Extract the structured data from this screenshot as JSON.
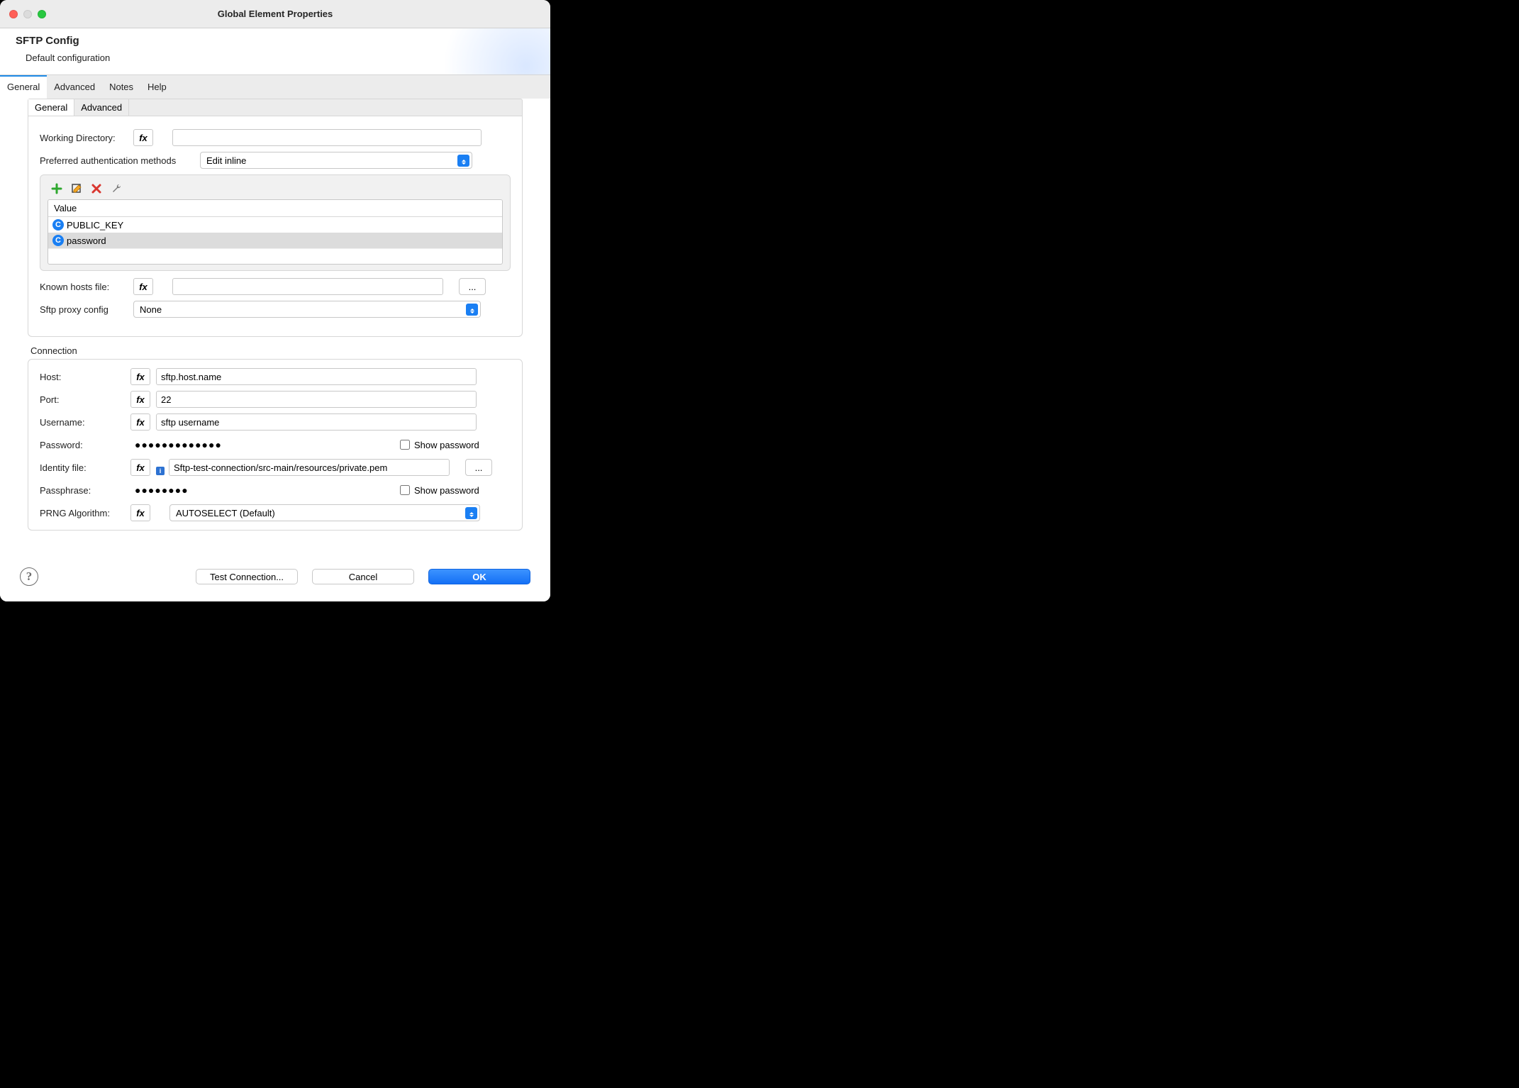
{
  "window": {
    "title": "Global Element Properties",
    "config_name": "SFTP Config",
    "config_subtitle": "Default configuration"
  },
  "outer_tabs": [
    "General",
    "Advanced",
    "Notes",
    "Help"
  ],
  "outer_tab_active": 0,
  "inner_tabs": [
    "General",
    "Advanced"
  ],
  "inner_tab_active": 0,
  "general": {
    "working_dir_label": "Working Directory:",
    "working_dir_value": "",
    "auth_methods_label": "Preferred authentication methods",
    "auth_methods_select": "Edit inline",
    "auth_list_header": "Value",
    "auth_list_items": [
      "PUBLIC_KEY",
      "password"
    ],
    "auth_list_selected": 1,
    "known_hosts_label": "Known hosts file:",
    "known_hosts_value": "",
    "proxy_label": "Sftp proxy config",
    "proxy_value": "None",
    "fx_label": "fx",
    "browse_label": "..."
  },
  "connection": {
    "section_title": "Connection",
    "host_label": "Host:",
    "host_value": "sftp.host.name",
    "port_label": "Port:",
    "port_value": "22",
    "user_label": "Username:",
    "user_value": "sftp username",
    "password_label": "Password:",
    "password_value": "●●●●●●●●●●●●●",
    "show_password_label": "Show password",
    "identity_label": "Identity file:",
    "identity_value": "Sftp-test-connection/src-main/resources/private.pem",
    "passphrase_label": "Passphrase:",
    "passphrase_value": "●●●●●●●●",
    "prng_label": "PRNG Algorithm:",
    "prng_value": "AUTOSELECT (Default)"
  },
  "footer": {
    "test_conn": "Test Connection...",
    "cancel": "Cancel",
    "ok": "OK"
  }
}
